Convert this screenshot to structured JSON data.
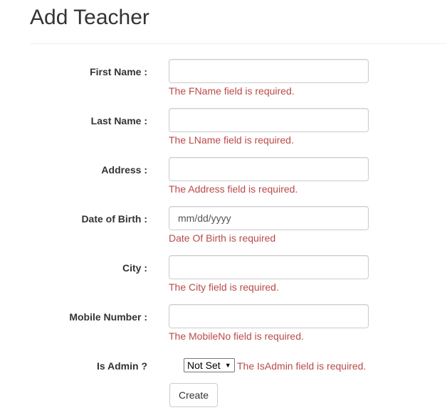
{
  "page": {
    "title": "Add Teacher"
  },
  "form": {
    "fields": [
      {
        "label": "First Name :",
        "value": "",
        "placeholder": "",
        "error": "The FName field is required."
      },
      {
        "label": "Last Name :",
        "value": "",
        "placeholder": "",
        "error": "The LName field is required."
      },
      {
        "label": "Address :",
        "value": "",
        "placeholder": "",
        "error": "The Address field is required."
      },
      {
        "label": "Date of Birth :",
        "value": "",
        "placeholder": "mm/dd/yyyy",
        "error": "Date Of Birth is required"
      },
      {
        "label": "City :",
        "value": "",
        "placeholder": "",
        "error": "The City field is required."
      },
      {
        "label": "Mobile Number :",
        "value": "",
        "placeholder": "",
        "error": "The MobileNo field is required."
      }
    ],
    "is_admin": {
      "label": "Is Admin ?",
      "selected": "Not Set",
      "error": "The IsAdmin field is required."
    },
    "submit_label": "Create"
  },
  "colors": {
    "error": "#b94a48",
    "text": "#333333",
    "input_border": "#cccccc"
  }
}
